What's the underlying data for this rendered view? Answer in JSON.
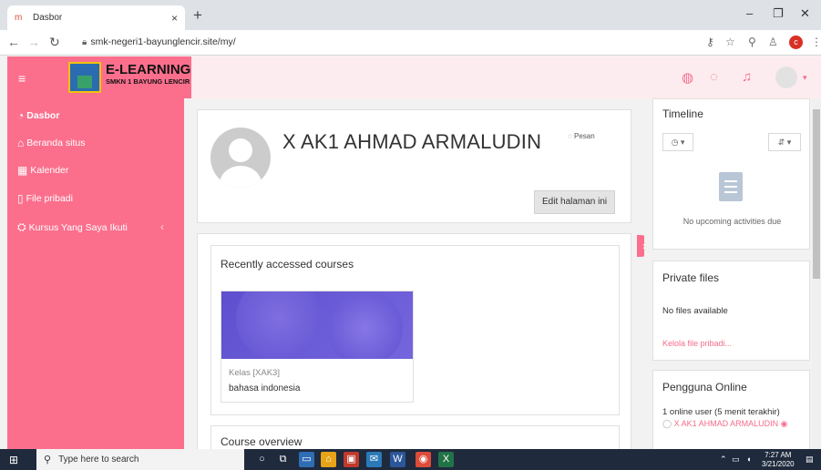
{
  "browser": {
    "tab_title": "Dasbor",
    "tab_close": "×",
    "new_tab": "+",
    "url": "smk-negeri1-bayunglencir.site/my/",
    "profile_initial": "c",
    "win_min": "–",
    "win_max": "❐",
    "win_close": "✕"
  },
  "header": {
    "brand_title": "E-LEARNING",
    "brand_subtitle": "SMKN 1 BAYUNG LENCIR"
  },
  "sidebar": {
    "items": [
      {
        "label": "Dasbor",
        "icon": "dashboard-icon"
      },
      {
        "label": "Beranda situs",
        "icon": "home-icon"
      },
      {
        "label": "Kalender",
        "icon": "calendar-icon"
      },
      {
        "label": "File pribadi",
        "icon": "file-icon"
      },
      {
        "label": "Kursus Yang Saya Ikuti",
        "icon": "graduation-cap-icon"
      }
    ]
  },
  "profile": {
    "name": "X AK1 AHMAD ARMALUDIN",
    "message_label": "Pesan",
    "edit_button": "Edit halaman ini"
  },
  "recent": {
    "title": "Recently accessed courses",
    "course_category": "Kelas [XAK3]",
    "course_name": "bahasa indonesia"
  },
  "overview": {
    "title": "Course overview"
  },
  "timeline": {
    "title": "Timeline",
    "empty": "No upcoming activities due"
  },
  "private_files": {
    "title": "Private files",
    "empty": "No files available",
    "manage_link": "Kelola file pribadi..."
  },
  "online": {
    "title": "Pengguna Online",
    "summary": "1 online user (5 menit terakhir)",
    "user": "X AK1 AHMAD ARMALUDIN"
  },
  "taskbar": {
    "search_placeholder": "Type here to search",
    "time": "7:27 AM",
    "date": "3/21/2020"
  },
  "colors": {
    "accent": "#fb6f8d",
    "header_bg": "#fdecef",
    "taskbar": "#1f2a3d"
  }
}
